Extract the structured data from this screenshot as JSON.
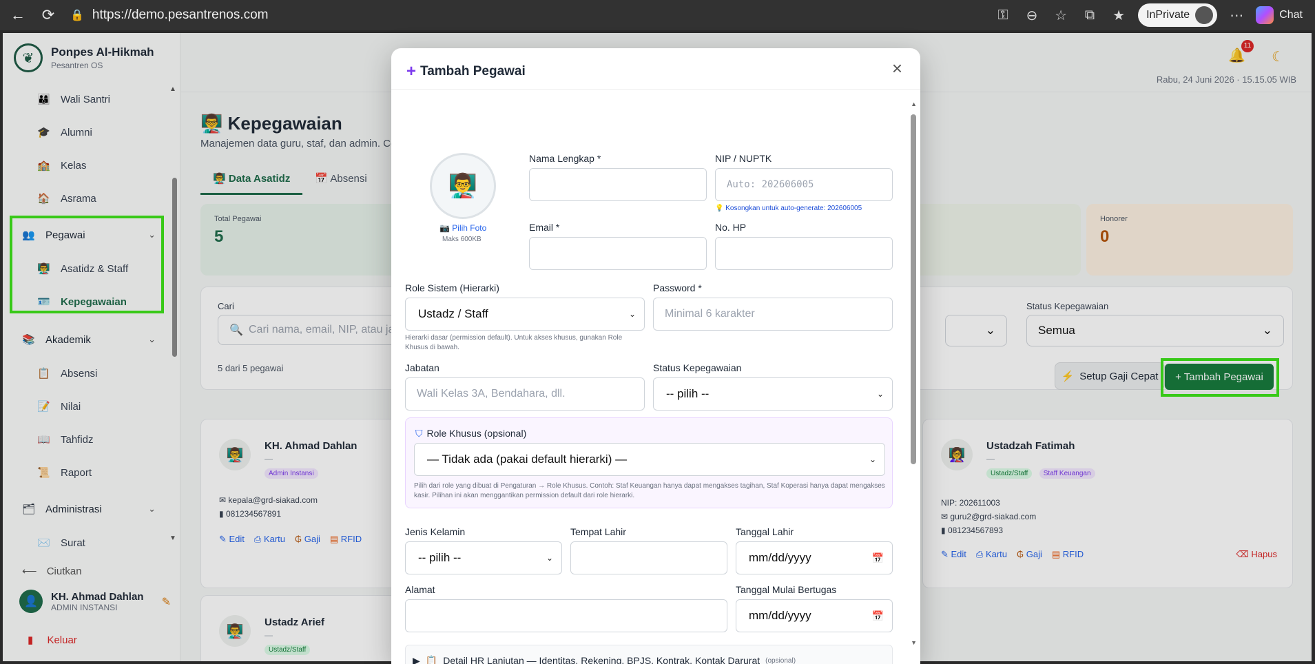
{
  "browser": {
    "url": "https://demo.pesantrenos.com",
    "inprivate": "InPrivate",
    "chat": "Chat"
  },
  "brand": {
    "name": "Ponpes Al-Hikmah",
    "subtitle": "Pesantren OS"
  },
  "sidebar": {
    "items": [
      {
        "icon": "👨‍👩‍👦",
        "label": "Wali Santri"
      },
      {
        "icon": "🎓",
        "label": "Alumni"
      },
      {
        "icon": "🏫",
        "label": "Kelas"
      },
      {
        "icon": "🏠",
        "label": "Asrama"
      }
    ],
    "group_pegawai": {
      "icon": "👥",
      "label": "Pegawai"
    },
    "pegawai_items": [
      {
        "icon": "👨‍🏫",
        "label": "Asatidz & Staff"
      },
      {
        "icon": "🪪",
        "label": "Kepegawaian"
      }
    ],
    "group_akademik": {
      "icon": "📚",
      "label": "Akademik"
    },
    "akademik_items": [
      {
        "icon": "📋",
        "label": "Absensi"
      },
      {
        "icon": "📝",
        "label": "Nilai"
      },
      {
        "icon": "📖",
        "label": "Tahfidz"
      },
      {
        "icon": "📜",
        "label": "Raport"
      }
    ],
    "group_admin": {
      "icon": "🗂",
      "label": "Administrasi"
    },
    "admin_items": [
      {
        "icon": "✉️",
        "label": "Surat"
      }
    ],
    "collapse": "Ciutkan",
    "user": {
      "initial": "👤",
      "name": "KH. Ahmad Dahlan",
      "role": "ADMIN INSTANSI"
    },
    "logout": "Keluar"
  },
  "topbar": {
    "badge": "11",
    "datetime": "Rabu, 24 Juni 2026 · 15.15.05 WIB"
  },
  "page": {
    "title": "Kepegawaian",
    "subtitle": "Manajemen data guru, staf, dan admin. Cet",
    "tabs": [
      "Data Asatidz",
      "Absensi"
    ]
  },
  "stats": [
    {
      "label": "Total Pegawai",
      "value": "5",
      "color": "#1e6b4a"
    },
    {
      "label": "Honorer",
      "value": "0",
      "color": "#b45309"
    }
  ],
  "filters": {
    "search_label": "Cari",
    "search_placeholder": "Cari nama, email, NIP, atau ja",
    "status_label": "Status Kepegawaian",
    "status_value": "Semua",
    "count": "5 dari 5 pegawai",
    "setup_btn": "Setup Gaji Cepat",
    "add_btn": "+ Tambah Pegawai"
  },
  "employees": [
    {
      "name": "KH. Ahmad Dahlan",
      "dash": "—",
      "badges": [
        "Admin Instansi"
      ],
      "email": "kepala@grd-siakad.com",
      "phone": "081234567891"
    },
    {
      "name": "Ustadzah Fatimah",
      "dash": "—",
      "badges": [
        "Ustadz/Staff",
        "Staff Keuangan"
      ],
      "nip": "NIP: 202611003",
      "email": "guru2@grd-siakad.com",
      "phone": "081234567893"
    },
    {
      "name": "Ustadz Arief",
      "dash": "—",
      "badges": [
        "Ustadz/Staff"
      ]
    }
  ],
  "actions": {
    "edit": "Edit",
    "kartu": "Kartu",
    "gaji": "Gaji",
    "rfid": "RFID",
    "hapus": "Hapus"
  },
  "modal": {
    "title": "Tambah Pegawai",
    "photo_link": "Pilih Foto",
    "photo_max": "Maks 600KB",
    "nama_label": "Nama Lengkap *",
    "nip_label": "NIP / NUPTK",
    "nip_placeholder": "Auto: 202606005",
    "nip_hint": "Kosongkan untuk auto-generate: 202606005",
    "email_label": "Email *",
    "hp_label": "No. HP",
    "role_label": "Role Sistem (Hierarki)",
    "role_value": "Ustadz / Staff",
    "role_hint": "Hierarki dasar (permission default). Untuk akses khusus, gunakan Role Khusus di bawah.",
    "password_label": "Password *",
    "password_placeholder": "Minimal 6 karakter",
    "jabatan_label": "Jabatan",
    "jabatan_placeholder": "Wali Kelas 3A, Bendahara, dll.",
    "status_label": "Status Kepegawaian",
    "status_value": "-- pilih --",
    "role_khusus_title": "Role Khusus (opsional)",
    "role_khusus_value": "— Tidak ada (pakai default hierarki) —",
    "role_khusus_hint": "Pilih dari role yang dibuat di Pengaturan → Role Khusus. Contoh: Staf Keuangan hanya dapat mengakses tagihan, Staf Koperasi hanya dapat mengakses kasir. Pilihan ini akan menggantikan permission default dari role hierarki.",
    "jk_label": "Jenis Kelamin",
    "jk_value": "-- pilih --",
    "tempat_label": "Tempat Lahir",
    "tgl_lahir_label": "Tanggal Lahir",
    "tgl_placeholder": "mm/dd/yyyy",
    "alamat_label": "Alamat",
    "tgl_mulai_label": "Tanggal Mulai Bertugas",
    "detail_hr": "Detail HR Lanjutan — Identitas, Rekening, BPJS, Kontrak, Kontak Darurat",
    "detail_opt": "(opsional)"
  }
}
